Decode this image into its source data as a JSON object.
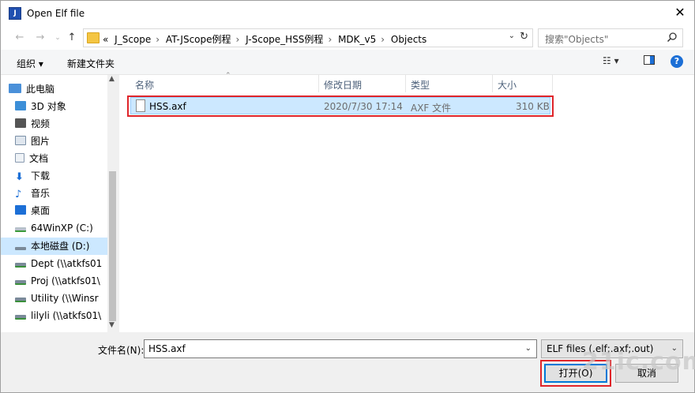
{
  "window": {
    "title": "Open Elf file",
    "close": "✕"
  },
  "nav": {
    "breadcrumbs": [
      "J_Scope",
      "AT-JScope例程",
      "J-Scope_HSS例程",
      "MDK_v5",
      "Objects"
    ],
    "overflow": "«",
    "search_placeholder": "搜索\"Objects\""
  },
  "toolbar": {
    "organize": "组织 ▾",
    "new_folder": "新建文件夹"
  },
  "sidebar": {
    "items": [
      {
        "label": "此电脑",
        "icon": "computer-icon",
        "color": "#4a90d9"
      },
      {
        "label": "3D 对象",
        "icon": "cube-3d-icon",
        "color": "#3c8fd8"
      },
      {
        "label": "视频",
        "icon": "video-icon",
        "color": "#555555"
      },
      {
        "label": "图片",
        "icon": "picture-icon",
        "color": "#7a8fa6"
      },
      {
        "label": "文档",
        "icon": "document-icon",
        "color": "#8a9bb0"
      },
      {
        "label": "下载",
        "icon": "download-icon",
        "color": "#1c6fd6"
      },
      {
        "label": "音乐",
        "icon": "music-icon",
        "color": "#1c6fd6"
      },
      {
        "label": "桌面",
        "icon": "desktop-icon",
        "color": "#1c6fd6"
      },
      {
        "label": "64WinXP (C:)",
        "icon": "drive-icon",
        "color": "#7a8a99"
      },
      {
        "label": "本地磁盘 (D:)",
        "icon": "drive-icon",
        "color": "#7a8a99"
      },
      {
        "label": "Dept (\\\\atkfs01",
        "icon": "network-drive-icon",
        "color": "#3a8f3a"
      },
      {
        "label": "Proj (\\\\atkfs01\\",
        "icon": "network-drive-icon",
        "color": "#3a8f3a"
      },
      {
        "label": "Utility (\\\\Winsr",
        "icon": "network-drive-icon",
        "color": "#3a8f3a"
      },
      {
        "label": "lilyli (\\\\atkfs01\\",
        "icon": "network-drive-icon",
        "color": "#3a8f3a"
      }
    ]
  },
  "columns": {
    "name": "名称",
    "modified": "修改日期",
    "type": "类型",
    "size": "大小"
  },
  "files": [
    {
      "name": "HSS.axf",
      "modified": "2020/7/30 17:14",
      "type": "AXF 文件",
      "size": "310 KB"
    }
  ],
  "bottom": {
    "filename_label": "文件名(N):",
    "filename_value": "HSS.axf",
    "filter": "ELF files (.elf;.axf;.out)",
    "open": "打开(O)",
    "cancel": "取消"
  },
  "watermark": "21ic.com",
  "colors": {
    "highlight": "#e0252a",
    "selection": "#cce8ff",
    "accent": "#0078d7"
  }
}
